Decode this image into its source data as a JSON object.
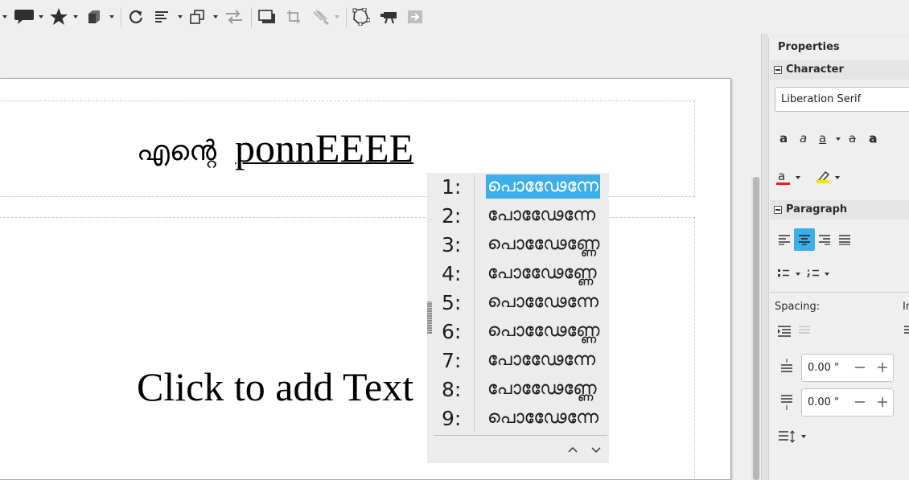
{
  "colors": {
    "accent": "#3daee9",
    "font_color_bar": "#e02020",
    "highlight_bar": "#f0e020"
  },
  "toolbar": {
    "icons": [
      "callout-icon",
      "star-icon",
      "cube-icon",
      "rotate-icon",
      "align-icon",
      "arrange-icon",
      "distribute-icon",
      "shadow-icon",
      "crop-icon",
      "filter-icon",
      "points-icon",
      "glue-icon",
      "toggle-extrusion-icon"
    ]
  },
  "slide": {
    "title_malayalam": "എന്റെ",
    "title_latin": "ponnEEEE",
    "body_placeholder": "Click to add Text"
  },
  "candidates": {
    "items": [
      {
        "num": "1:",
        "text": "പൊഢേേന്നേ"
      },
      {
        "num": "2:",
        "text": "പോഢേേന്നേ"
      },
      {
        "num": "3:",
        "text": "പൊഢേേണ്ണേ"
      },
      {
        "num": "4:",
        "text": "പോഢേേണ്ണേ"
      },
      {
        "num": "5:",
        "text": "പൊഢേേന്നേ"
      },
      {
        "num": "6:",
        "text": "പൊഢേേണ്ണേ"
      },
      {
        "num": "7:",
        "text": "പോഢേേന്നേ"
      },
      {
        "num": "8:",
        "text": "പോഢേേണ്ണേ"
      },
      {
        "num": "9:",
        "text": "പൊഢേേന്നേ"
      }
    ],
    "selected_index": 0
  },
  "sidebar": {
    "title": "Properties",
    "character": {
      "label": "Character",
      "font_name": "Liberation Serif",
      "format_glyph": "a",
      "font_color_glyph": "a"
    },
    "paragraph": {
      "label": "Paragraph",
      "spacing_label": "Spacing:",
      "indent_label": "In",
      "above_value": "0.00 \"",
      "below_value": "0.00 \""
    }
  }
}
